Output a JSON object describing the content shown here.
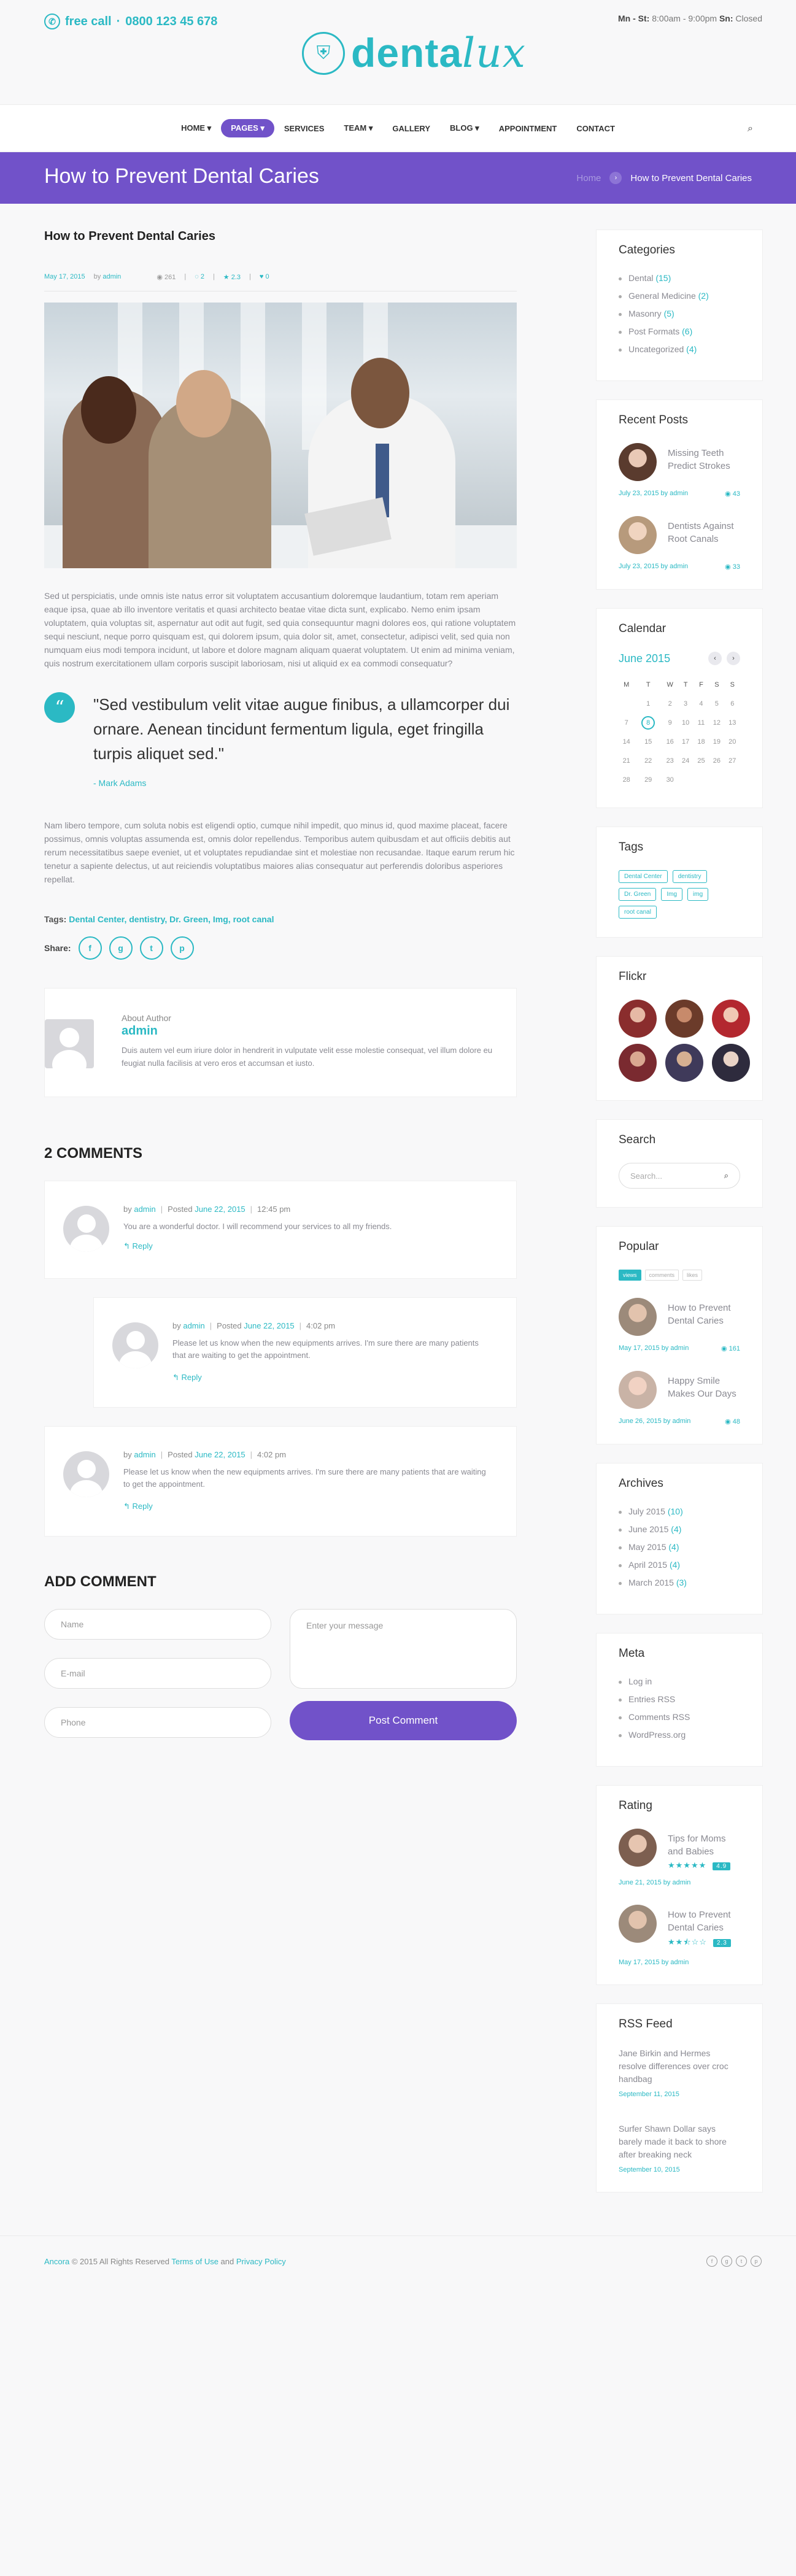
{
  "header": {
    "free_call_label": "free call",
    "phone": "0800 123 45 678",
    "hours_days": "Mn - St:",
    "hours_time": " 8:00am - 9:00pm ",
    "sunday_label": "Sn:",
    "sunday_value": " Closed",
    "logo_text_a": "denta",
    "logo_text_b": "lux"
  },
  "nav": {
    "items": [
      "HOME ▾",
      "PAGES ▾",
      "SERVICES",
      "TEAM ▾",
      "GALLERY",
      "BLOG ▾",
      "APPOINTMENT",
      "CONTACT"
    ]
  },
  "titlebar": {
    "title": "How to Prevent Dental Caries",
    "crumb_home": "Home",
    "crumb_current": "How to Prevent Dental Caries"
  },
  "post": {
    "title": "How to Prevent Dental Caries",
    "date": "May 17, 2015",
    "by": "by",
    "author": "admin",
    "views": "261",
    "comments": "2",
    "rating": "2.3",
    "likes": "0",
    "para1": "Sed ut perspiciatis, unde omnis iste natus error sit voluptatem accusantium doloremque laudantium, totam rem aperiam eaque ipsa, quae ab illo inventore veritatis et quasi architecto beatae vitae dicta sunt, explicabo. Nemo enim ipsam voluptatem, quia voluptas sit, aspernatur aut odit aut fugit, sed quia consequuntur magni dolores eos, qui ratione voluptatem sequi nesciunt, neque porro quisquam est, qui dolorem ipsum, quia dolor sit, amet, consectetur, adipisci velit, sed quia non numquam eius modi tempora incidunt, ut labore et dolore magnam aliquam quaerat voluptatem. Ut enim ad minima veniam, quis nostrum exercitationem ullam corporis suscipit laboriosam, nisi ut aliquid ex ea commodi consequatur?",
    "quote": "\"Sed vestibulum velit vitae augue finibus, a ullamcorper dui ornare. Aenean tincidunt fermentum ligula, eget fringilla turpis aliquet sed.\"",
    "quote_author": "- Mark Adams",
    "para2": "Nam libero tempore, cum soluta nobis est eligendi optio, cumque nihil impedit, quo minus id, quod maxime placeat, facere possimus, omnis voluptas assumenda est, omnis dolor repellendus. Temporibus autem quibusdam et aut officiis debitis aut rerum necessitatibus saepe eveniet, ut et voluptates repudiandae sint et molestiae non recusandae. Itaque earum rerum hic tenetur a sapiente delectus, ut aut reiciendis voluptatibus maiores alias consequatur aut perferendis doloribus asperiores repellat.",
    "tags_label": "Tags:",
    "tags": "Dental Center, dentistry, Dr. Green, Img, root canal",
    "share_label": "Share:"
  },
  "author_box": {
    "label": "About Author",
    "name": "admin",
    "bio": "Duis autem vel eum iriure dolor in hendrerit in vulputate velit esse molestie consequat, vel illum dolore eu feugiat nulla facilisis at vero eros et accumsan et iusto."
  },
  "comments": {
    "heading": "2 COMMENTS",
    "items": [
      {
        "by": "by ",
        "author": "admin",
        "posted": "Posted ",
        "date": "June 22, 2015",
        "time": "12:45 pm",
        "text": "You are a wonderful doctor. I will recommend your services to all my friends.",
        "reply": "Reply"
      },
      {
        "by": "by ",
        "author": "admin",
        "posted": "Posted ",
        "date": "June 22, 2015",
        "time": "4:02 pm",
        "text": "Please let us know when the new equipments arrives. I'm sure there are many patients that are waiting to get the appointment.",
        "reply": "Reply"
      },
      {
        "by": "by ",
        "author": "admin",
        "posted": "Posted ",
        "date": "June 22, 2015",
        "time": "4:02 pm",
        "text": "Please let us know when the new equipments arrives. I'm sure there are many patients that are waiting to get the appointment.",
        "reply": "Reply"
      }
    ]
  },
  "add_comment": {
    "heading": "ADD COMMENT",
    "name_ph": "Name",
    "email_ph": "E-mail",
    "phone_ph": "Phone",
    "message_ph": "Enter your message",
    "submit": "Post Comment"
  },
  "sidebar": {
    "categories": {
      "title": "Categories",
      "items": [
        {
          "label": "Dental ",
          "count": "(15)"
        },
        {
          "label": "General Medicine ",
          "count": "(2)"
        },
        {
          "label": "Masonry ",
          "count": "(5)"
        },
        {
          "label": "Post Formats ",
          "count": "(6)"
        },
        {
          "label": "Uncategorized ",
          "count": "(4)"
        }
      ]
    },
    "recent": {
      "title": "Recent Posts",
      "items": [
        {
          "title": "Missing Teeth Predict Strokes",
          "meta": "July 23, 2015 by admin",
          "views": "43"
        },
        {
          "title": "Dentists Against Root Canals",
          "meta": "July 23, 2015 by admin",
          "views": "33"
        }
      ]
    },
    "calendar": {
      "title": "Calendar",
      "month": "June 2015",
      "days": [
        "M",
        "T",
        "W",
        "T",
        "F",
        "S",
        "S"
      ],
      "weeks": [
        [
          "",
          "",
          "",
          "",
          "",
          "",
          ""
        ],
        [
          "",
          "",
          "",
          "",
          "",
          "",
          ""
        ],
        [
          "",
          "",
          "",
          "",
          "",
          "",
          ""
        ],
        [
          "",
          "",
          "",
          "",
          "",
          "",
          ""
        ],
        [
          "",
          "",
          "",
          "",
          "",
          "",
          ""
        ]
      ],
      "cells": [
        "1",
        "2",
        "3",
        "4",
        "5",
        "6",
        "7",
        "8",
        "9",
        "10",
        "11",
        "12",
        "13",
        "14",
        "15",
        "16",
        "17",
        "18",
        "19",
        "20",
        "21",
        "22",
        "23",
        "24",
        "25",
        "26",
        "27",
        "28",
        "29",
        "30"
      ],
      "today": "8"
    },
    "tags": {
      "title": "Tags",
      "items": [
        "Dental Center",
        "dentistry",
        "Dr. Green",
        "Img",
        "img",
        "root canal"
      ]
    },
    "flickr": {
      "title": "Flickr"
    },
    "search": {
      "title": "Search",
      "placeholder": "Search..."
    },
    "popular": {
      "title": "Popular",
      "tabs": [
        "views",
        "comments",
        "likes"
      ],
      "items": [
        {
          "title": "How to Prevent Dental Caries",
          "meta": "May 17, 2015 by admin",
          "views": "161"
        },
        {
          "title": "Happy Smile Makes Our Days",
          "meta": "June 26, 2015 by admin",
          "views": "48"
        }
      ]
    },
    "archives": {
      "title": "Archives",
      "items": [
        {
          "label": "July 2015 ",
          "count": "(10)"
        },
        {
          "label": "June 2015 ",
          "count": "(4)"
        },
        {
          "label": "May 2015 ",
          "count": "(4)"
        },
        {
          "label": "April 2015 ",
          "count": "(4)"
        },
        {
          "label": "March 2015 ",
          "count": "(3)"
        }
      ]
    },
    "meta": {
      "title": "Meta",
      "items": [
        "Log in",
        "Entries RSS",
        "Comments RSS",
        "WordPress.org"
      ]
    },
    "rating": {
      "title": "Rating",
      "items": [
        {
          "title": "Tips for Moms and Babies",
          "stars": "★★★★★",
          "score": "4.9",
          "meta": "June 21, 2015 by admin"
        },
        {
          "title": "How to Prevent Dental Caries",
          "stars": "★★⯪☆☆",
          "score": "2.3",
          "meta": "May 17, 2015 by admin"
        }
      ]
    },
    "rss": {
      "title": "RSS Feed",
      "items": [
        {
          "title": "Jane Birkin and Hermes resolve differences over croc handbag",
          "date": "September 11, 2015"
        },
        {
          "title": "Surfer Shawn Dollar says barely made it back to shore after breaking neck",
          "date": "September 10, 2015"
        }
      ]
    }
  },
  "footer": {
    "brand": "Ancora",
    "copy": " © 2015 All Rights Reserved ",
    "terms": "Terms of Use",
    "and": " and ",
    "privacy": "Privacy Policy"
  },
  "colors": {
    "accent": "#2bb9c4",
    "brand": "#7152c9"
  }
}
